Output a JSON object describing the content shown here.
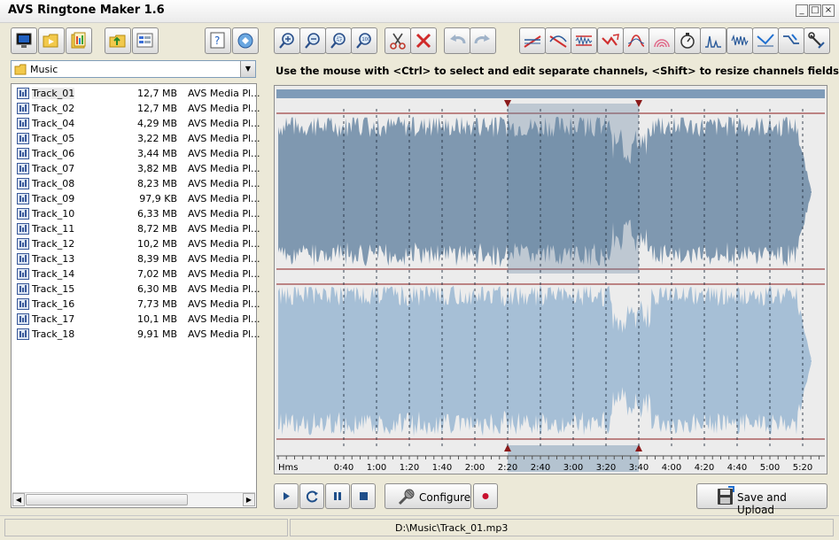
{
  "window": {
    "title": "AVS Ringtone Maker 1.6"
  },
  "toolbar_left": [
    {
      "name": "my-computer-icon"
    },
    {
      "name": "add-folder-icon"
    },
    {
      "name": "open-files-icon"
    },
    {
      "name": "folder-up-icon"
    },
    {
      "name": "view-mode-icon"
    },
    {
      "name": "help-icon"
    },
    {
      "name": "about-icon"
    }
  ],
  "toolbar_edit": [
    {
      "name": "zoom-in-icon"
    },
    {
      "name": "zoom-out-icon"
    },
    {
      "name": "zoom-selection-icon"
    },
    {
      "name": "zoom-fit-icon"
    },
    {
      "name": "cut-icon"
    },
    {
      "name": "delete-icon"
    },
    {
      "name": "undo-icon"
    },
    {
      "name": "redo-icon"
    }
  ],
  "toolbar_effects": [
    {
      "name": "fade-in-icon"
    },
    {
      "name": "fade-out-icon"
    },
    {
      "name": "normalize-icon"
    },
    {
      "name": "reverse-icon"
    },
    {
      "name": "amplify-icon"
    },
    {
      "name": "echo-icon"
    },
    {
      "name": "tempo-icon"
    },
    {
      "name": "equalizer-icon"
    },
    {
      "name": "chorus-icon"
    },
    {
      "name": "pitch-icon"
    },
    {
      "name": "compressor-icon"
    },
    {
      "name": "tools-icon"
    }
  ],
  "folder": {
    "selected": "Music"
  },
  "files": [
    {
      "name": "Track_01",
      "size": "12,7 MB",
      "author": "AVS Media Pl..."
    },
    {
      "name": "Track_02",
      "size": "12,7 MB",
      "author": "AVS Media Pl..."
    },
    {
      "name": "Track_04",
      "size": "4,29 MB",
      "author": "AVS Media Pl..."
    },
    {
      "name": "Track_05",
      "size": "3,22 MB",
      "author": "AVS Media Pl..."
    },
    {
      "name": "Track_06",
      "size": "3,44 MB",
      "author": "AVS Media Pl..."
    },
    {
      "name": "Track_07",
      "size": "3,82 MB",
      "author": "AVS Media Pl..."
    },
    {
      "name": "Track_08",
      "size": "8,23 MB",
      "author": "AVS Media Pl..."
    },
    {
      "name": "Track_09",
      "size": "97,9 KB",
      "author": "AVS Media Pl..."
    },
    {
      "name": "Track_10",
      "size": "6,33 MB",
      "author": "AVS Media Pl..."
    },
    {
      "name": "Track_11",
      "size": "8,72 MB",
      "author": "AVS Media Pl..."
    },
    {
      "name": "Track_12",
      "size": "10,2 MB",
      "author": "AVS Media Pl..."
    },
    {
      "name": "Track_13",
      "size": "8,39 MB",
      "author": "AVS Media Pl..."
    },
    {
      "name": "Track_14",
      "size": "7,02 MB",
      "author": "AVS Media Pl..."
    },
    {
      "name": "Track_15",
      "size": "6,30 MB",
      "author": "AVS Media Pl..."
    },
    {
      "name": "Track_16",
      "size": "7,73 MB",
      "author": "AVS Media Pl..."
    },
    {
      "name": "Track_17",
      "size": "10,1 MB",
      "author": "AVS Media Pl..."
    },
    {
      "name": "Track_18",
      "size": "9,91 MB",
      "author": "AVS Media Pl..."
    }
  ],
  "hint": "Use the mouse with <Ctrl> to select and edit separate channels, <Shift> to resize channels fields",
  "timeline": {
    "unit_label": "Hms",
    "ticks": [
      "0:40",
      "1:00",
      "1:20",
      "1:40",
      "2:00",
      "2:20",
      "2:40",
      "3:00",
      "3:20",
      "3:40",
      "4:00",
      "4:20",
      "4:40",
      "5:00",
      "5:20"
    ],
    "selection_start": "2:20",
    "selection_end": "3:40"
  },
  "transport": {
    "play_icon": "play-icon",
    "loop_icon": "loop-icon",
    "pause_icon": "pause-icon",
    "stop_icon": "stop-icon",
    "configure_label": "Configure",
    "record_icon": "record-icon",
    "save_label": "Save and Upload"
  },
  "status": {
    "path": "D:\\Music\\Track_01.mp3"
  },
  "colors": {
    "waveform_top": "#7f98b0",
    "waveform_top_selected": "#6a88a3",
    "waveform_bottom": "#a6bfd6",
    "selection": "#b4c3d0",
    "marker": "#8b1a1a"
  }
}
